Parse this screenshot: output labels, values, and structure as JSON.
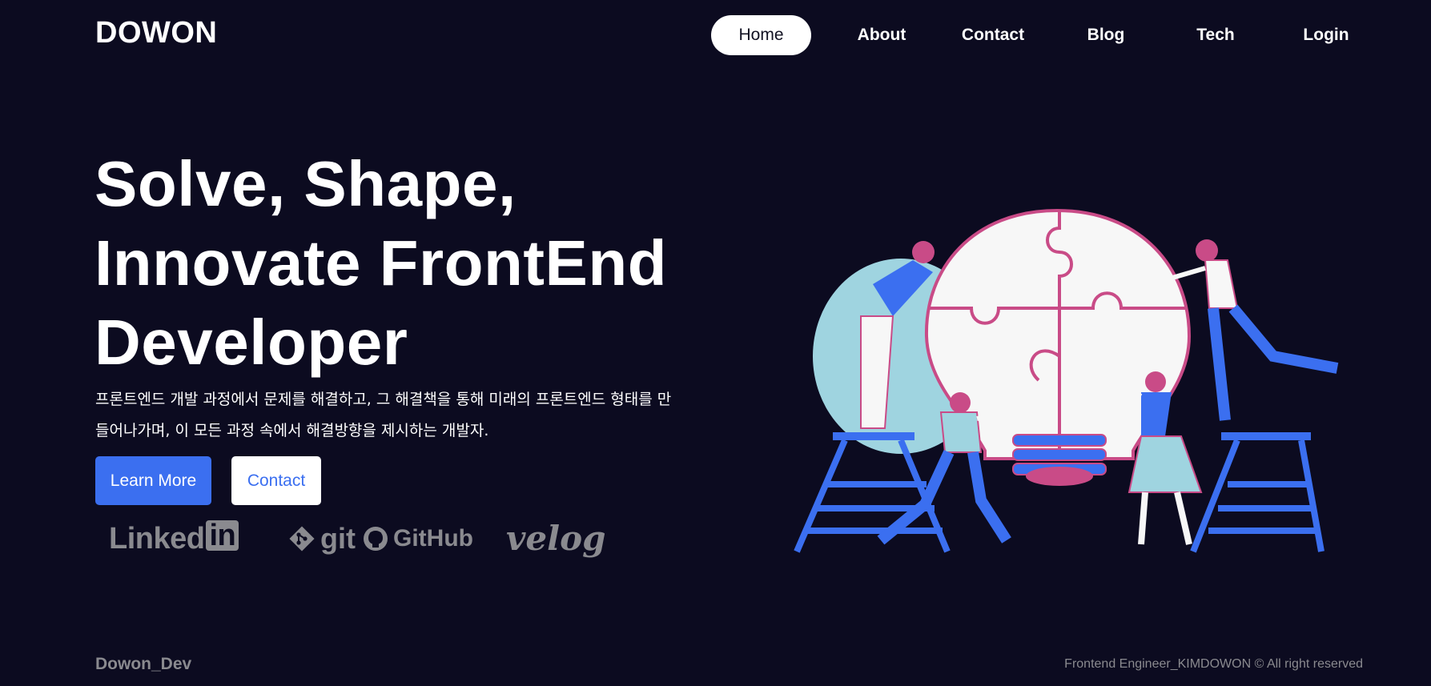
{
  "header": {
    "logo": "DOWON",
    "nav": [
      "Home",
      "About",
      "Contact",
      "Blog",
      "Tech",
      "Login"
    ],
    "active": "Home"
  },
  "hero": {
    "title_line1": "Solve, Shape,",
    "title_line2": "Innovate FrontEnd",
    "title_line3": "Developer",
    "description": "프론트엔드 개발 과정에서 문제를 해결하고, 그 해결책을 통해 미래의 프론트엔드 형태를 만들어나가며, 이 모든 과정 속에서 해결방향을 제시하는 개발자.",
    "primary_button": "Learn More",
    "secondary_button": "Contact"
  },
  "social": {
    "linkedin_text": "Linked",
    "linkedin_box": "in",
    "git": "git",
    "github": "GitHub",
    "velog": "velog"
  },
  "footer": {
    "brand": "Dowon_Dev",
    "copyright": "Frontend Engineer_KIMDOWON © All right reserved"
  },
  "colors": {
    "background": "#0c0b20",
    "accent": "#3b6ff0",
    "muted": "#8a8a8f",
    "illustration_pink": "#c94b87",
    "illustration_light_blue": "#9fd4e0"
  },
  "icons": [
    "git-icon",
    "github-icon",
    "puzzle-lightbulb-illustration"
  ]
}
